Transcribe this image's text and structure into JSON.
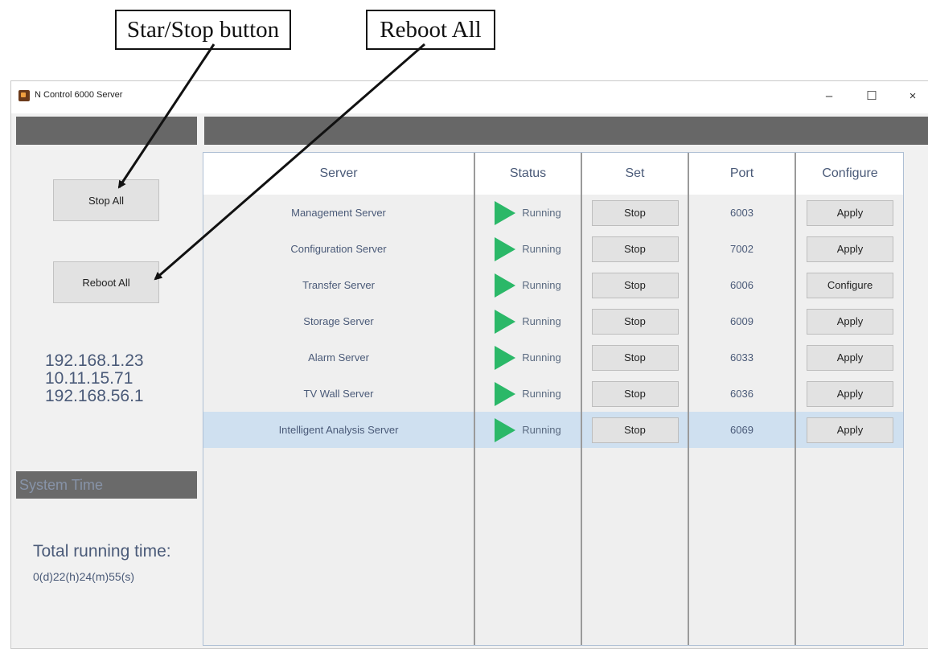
{
  "annotations": {
    "start_stop_label": "Star/Stop button",
    "reboot_label": "Reboot All"
  },
  "window": {
    "title": "N Control 6000 Server",
    "minimize": "–",
    "maximize": "☐",
    "close": "×"
  },
  "sidebar": {
    "stop_all": "Stop All",
    "reboot_all": "Reboot All",
    "ip_addresses": [
      "192.168.1.23",
      "10.11.15.71",
      "192.168.56.1"
    ],
    "system_time_label": "System Time",
    "total_running_time_label": "Total running time:",
    "total_running_time_value": "0(d)22(h)24(m)55(s)"
  },
  "table": {
    "headers": [
      "Server",
      "Status",
      "Set",
      "Port",
      "Configure"
    ],
    "rows": [
      {
        "server": "Management Server",
        "status": "Running",
        "set": "Stop",
        "port": "6003",
        "configure": "Apply"
      },
      {
        "server": "Configuration Server",
        "status": "Running",
        "set": "Stop",
        "port": "7002",
        "configure": "Apply"
      },
      {
        "server": "Transfer Server",
        "status": "Running",
        "set": "Stop",
        "port": "6006",
        "configure": "Configure"
      },
      {
        "server": "Storage Server",
        "status": "Running",
        "set": "Stop",
        "port": "6009",
        "configure": "Apply"
      },
      {
        "server": "Alarm Server",
        "status": "Running",
        "set": "Stop",
        "port": "6033",
        "configure": "Apply"
      },
      {
        "server": "TV Wall Server",
        "status": "Running",
        "set": "Stop",
        "port": "6036",
        "configure": "Apply"
      },
      {
        "server": "Intelligent Analysis Server",
        "status": "Running",
        "set": "Stop",
        "port": "6069",
        "configure": "Apply",
        "selected": true
      }
    ]
  },
  "icons": {
    "status_icon": "play-triangle-icon",
    "app_icon": "app-logo-icon"
  },
  "colors": {
    "running_green": "#2bb868",
    "header_bar": "#676767",
    "selected_row": "#cfe0f0",
    "text_blue": "#4a5a78"
  }
}
